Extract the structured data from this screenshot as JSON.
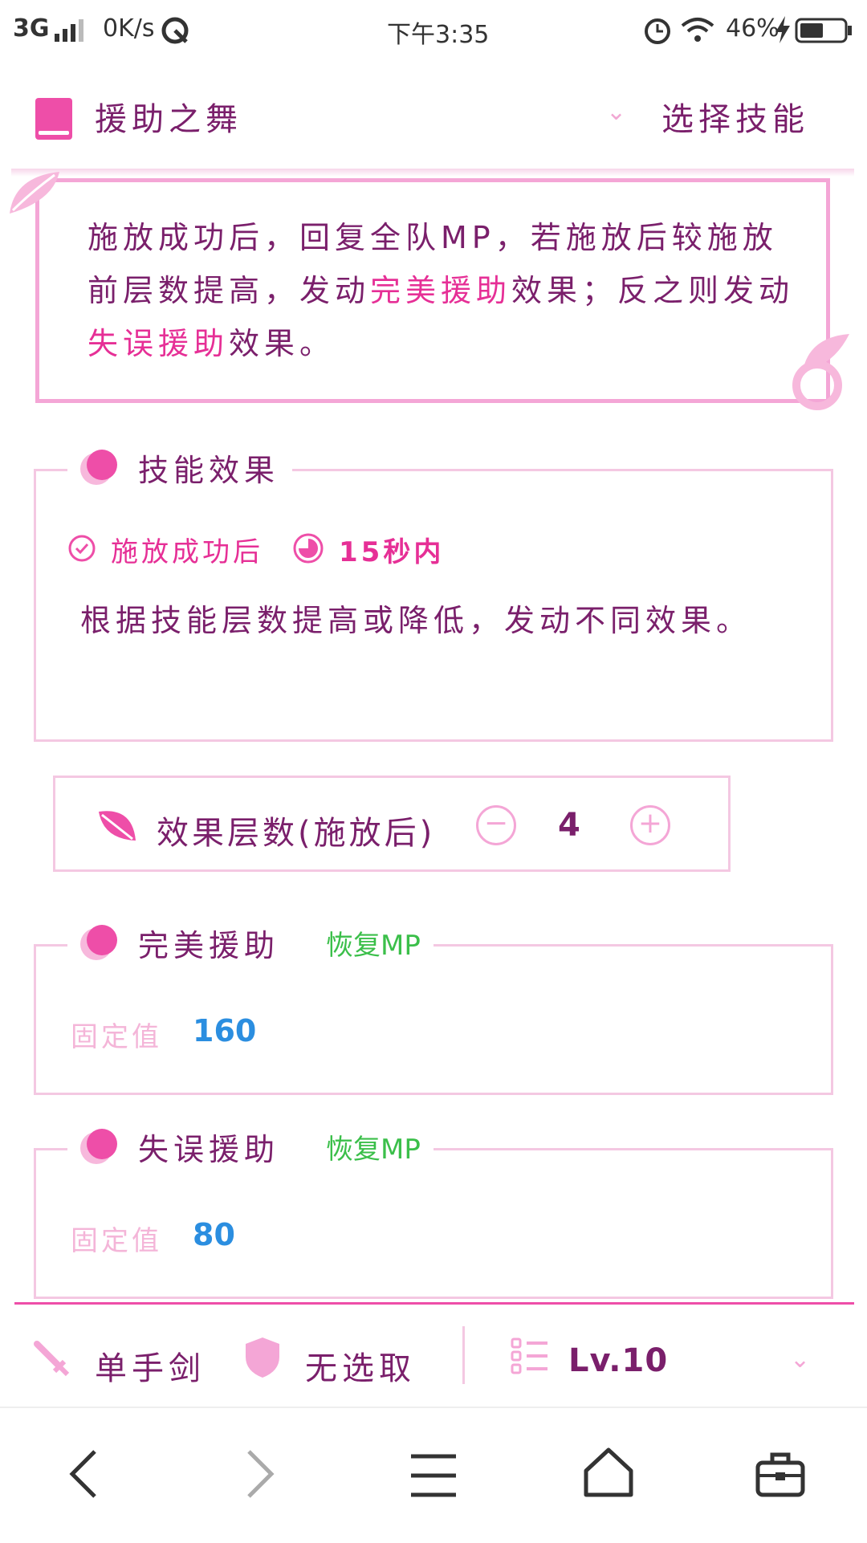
{
  "status_bar": {
    "network": "3G",
    "speed": "0K/s",
    "time": "下午3:35",
    "battery": "46%"
  },
  "header": {
    "title": "援助之舞",
    "select_label": "选择技能"
  },
  "description": {
    "part1": "施放成功后，回复全队MP，若施放后较施放前层数提高，发动",
    "highlight1": "完美援助",
    "part2": "效果；反之则发动",
    "highlight2": "失误援助",
    "part3": "效果。"
  },
  "skill_effect": {
    "title": "技能效果",
    "condition": "施放成功后",
    "duration": "15秒内",
    "text": "根据技能层数提高或降低，发动不同效果。"
  },
  "stepper": {
    "label": "效果层数(施放后)",
    "value": "4"
  },
  "perfect_assist": {
    "title": "完美援助",
    "tag": "恢复MP",
    "fixed_label": "固定值",
    "fixed_value": "160"
  },
  "failed_assist": {
    "title": "失误援助",
    "tag": "恢复MP",
    "fixed_label": "固定值",
    "fixed_value": "80"
  },
  "filters": {
    "weapon": "单手剑",
    "shield": "无选取",
    "level": "Lv.10"
  },
  "colors": {
    "accent": "#ee4ea8",
    "text": "#7a1f6b",
    "border": "#f4c8e2",
    "green": "#3bbf4a",
    "blue": "#2b8ee0"
  }
}
